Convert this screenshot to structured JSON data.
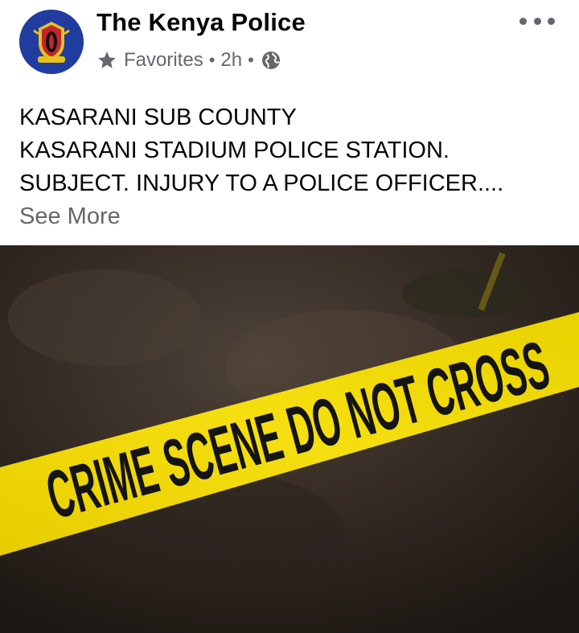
{
  "post": {
    "page_name": "The Kenya Police",
    "audience_label": "Favorites",
    "time": "2h",
    "separator": "•",
    "icons": {
      "favorites": "star-icon",
      "audience": "globe-icon",
      "menu": "more-options-icon"
    },
    "text_lines": [
      "KASARANI SUB COUNTY",
      "KASARANI STADIUM POLICE STATION.",
      "SUBJECT.  INJURY TO A POLICE OFFICER...."
    ],
    "see_more": "See More"
  },
  "image": {
    "tape_text": "CRIME SCENE DO NOT CROSS",
    "tape_color": "#f2d800",
    "ground_color": "#3a2f26"
  }
}
